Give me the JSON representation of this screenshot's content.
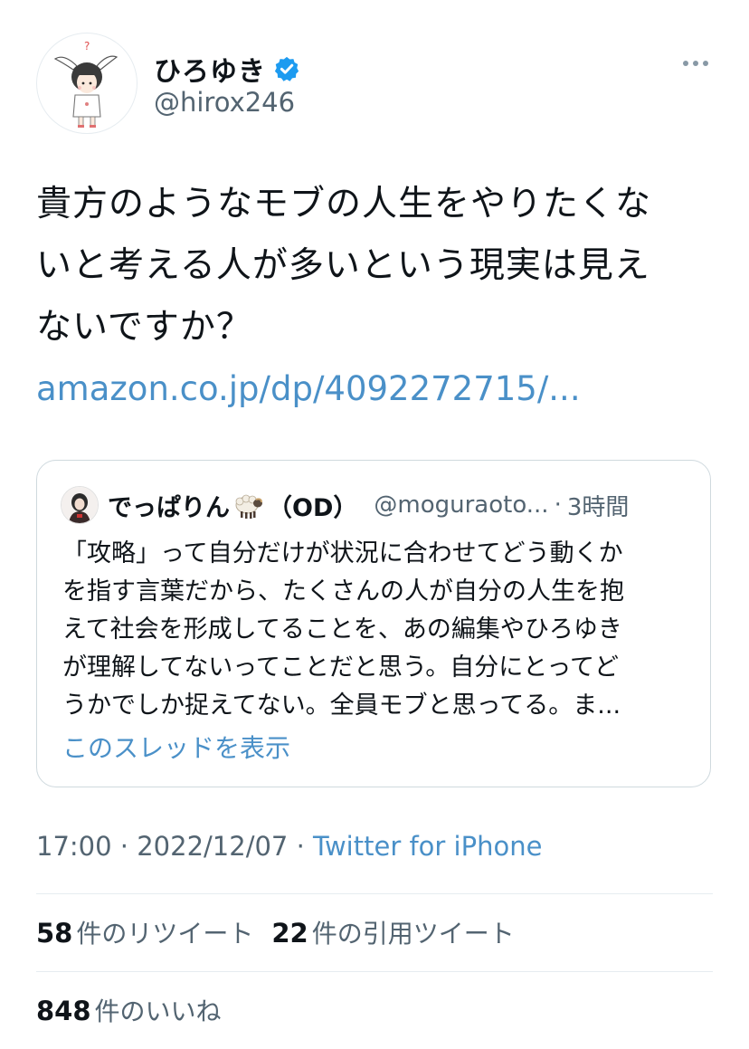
{
  "author": {
    "display_name": "ひろゆき",
    "handle": "@hirox246",
    "verified": true,
    "avatar_icon": "cartoon-bunny-avatar-icon"
  },
  "tweet": {
    "text_lines": [
      "貴方のようなモブの人生をやりたくな",
      "いと考える人が多いという現実は見え",
      "ないですか？"
    ],
    "link": "amazon.co.jp/dp/4092272715/..."
  },
  "quote": {
    "display_name": "でっぱりん",
    "emoji": "sheep-emoji",
    "name_suffix": "（OD）",
    "handle": "@moguraoto...",
    "separator": "·",
    "time": "3時間",
    "body_lines": [
      "「攻略」って自分だけが状況に合わせてどう動くか",
      "を指す言葉だから、たくさんの人が自分の人生を抱",
      "えて社会を形成してることを、あの編集やひろゆき",
      "が理解してないってことだと思う。自分にとってど",
      "うかでしか捉えてない。全員モブと思ってる。ま..."
    ],
    "show_thread": "このスレッドを表示"
  },
  "meta": {
    "time": "17:00",
    "sep1": " · ",
    "date": "2022/12/07",
    "sep2": " · ",
    "source": "Twitter for iPhone"
  },
  "stats": {
    "retweets_count": "58",
    "retweets_label": "件のリツイート",
    "quotes_count": "22",
    "quotes_label": "件の引用ツイート",
    "likes_count": "848",
    "likes_label": "件のいいね"
  },
  "colors": {
    "link": "#4a90c8",
    "verified": "#1d9bf0",
    "secondary_text": "#536471"
  }
}
